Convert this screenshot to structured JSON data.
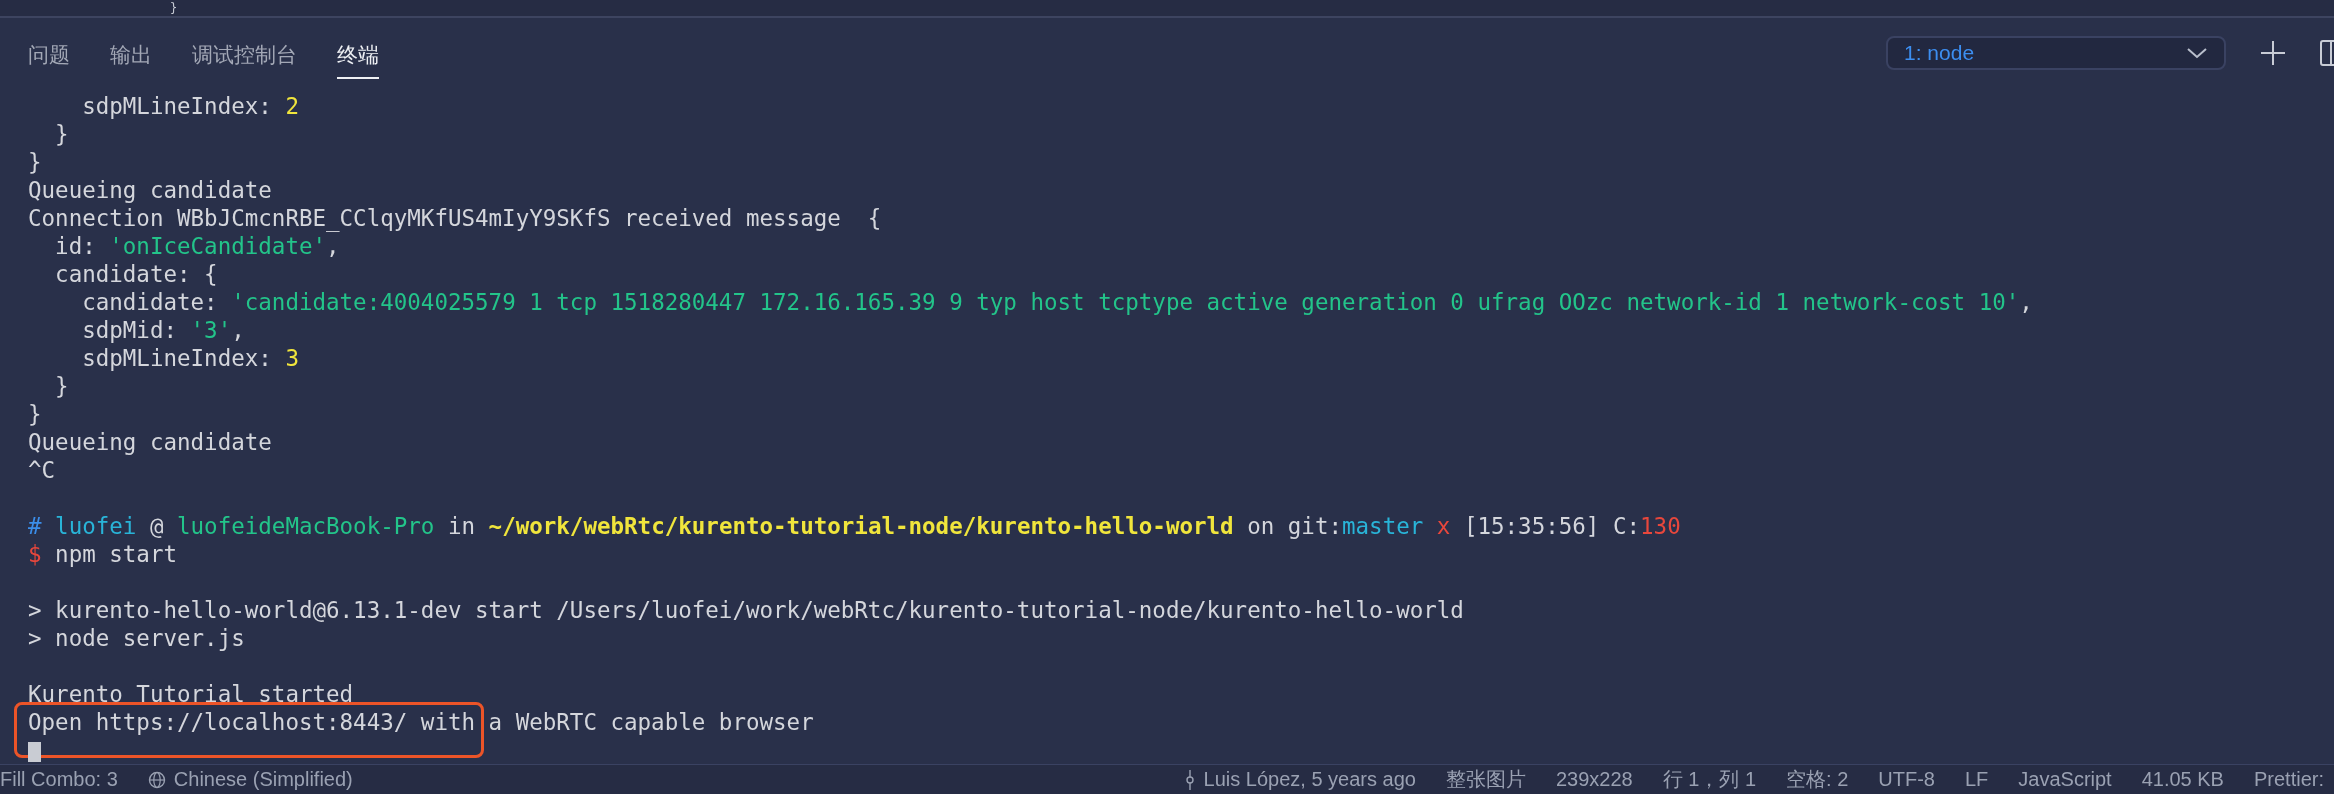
{
  "editor_remnant": {
    "text": "}"
  },
  "tabs": [
    {
      "label": "问题",
      "selected": false
    },
    {
      "label": "输出",
      "selected": false
    },
    {
      "label": "调试控制台",
      "selected": false
    },
    {
      "label": "终端",
      "selected": true
    }
  ],
  "terminal_select": {
    "value": "1: node"
  },
  "terminal": {
    "blocks": [
      {
        "lines": [
          {
            "segments": [
              {
                "text": "    sdpMLineIndex: ",
                "kind": "plain"
              },
              {
                "text": "2",
                "kind": "number"
              }
            ]
          },
          {
            "segments": [
              {
                "text": "  }",
                "kind": "plain"
              }
            ]
          },
          {
            "segments": [
              {
                "text": "}",
                "kind": "plain"
              }
            ]
          },
          {
            "segments": [
              {
                "text": "Queueing candidate",
                "kind": "plain"
              }
            ]
          },
          {
            "segments": [
              {
                "text": "Connection WBbJCmcnRBE_CClqyMKfUS4mIyY9SKfS received message  {",
                "kind": "plain"
              }
            ]
          },
          {
            "segments": [
              {
                "text": "  id: ",
                "kind": "plain"
              },
              {
                "text": "'onIceCandidate'",
                "kind": "string"
              },
              {
                "text": ",",
                "kind": "plain"
              }
            ]
          },
          {
            "segments": [
              {
                "text": "  candidate: {",
                "kind": "plain"
              }
            ]
          },
          {
            "segments": [
              {
                "text": "    candidate: ",
                "kind": "plain"
              },
              {
                "text": "'candidate:4004025579 1 tcp 1518280447 172.16.165.39 9 typ host tcptype active generation 0 ufrag OOzc network-id 1 network-cost 10'",
                "kind": "string"
              },
              {
                "text": ",",
                "kind": "plain"
              }
            ]
          },
          {
            "segments": [
              {
                "text": "    sdpMid: ",
                "kind": "plain"
              },
              {
                "text": "'3'",
                "kind": "string"
              },
              {
                "text": ",",
                "kind": "plain"
              }
            ]
          },
          {
            "segments": [
              {
                "text": "    sdpMLineIndex: ",
                "kind": "plain"
              },
              {
                "text": "3",
                "kind": "number"
              }
            ]
          },
          {
            "segments": [
              {
                "text": "  }",
                "kind": "plain"
              }
            ]
          },
          {
            "segments": [
              {
                "text": "}",
                "kind": "plain"
              }
            ]
          },
          {
            "segments": [
              {
                "text": "Queueing candidate",
                "kind": "plain"
              }
            ]
          },
          {
            "segments": [
              {
                "text": "^C",
                "kind": "plain"
              }
            ]
          }
        ]
      },
      {
        "lines": [
          {
            "segments": [
              {
                "text": "#",
                "kind": "hash"
              },
              {
                "text": " luofei",
                "kind": "user"
              },
              {
                "text": " @ ",
                "kind": "plain"
              },
              {
                "text": "luofeideMacBook-Pro",
                "kind": "host"
              },
              {
                "text": " in ",
                "kind": "plain"
              },
              {
                "text": "~/work/webRtc/kurento-tutorial-node/kurento-hello-world",
                "kind": "path"
              },
              {
                "text": " on git:",
                "kind": "plain"
              },
              {
                "text": "master",
                "kind": "user"
              },
              {
                "text": " x",
                "kind": "error"
              },
              {
                "text": " [15:35:56] C:",
                "kind": "plain"
              },
              {
                "text": "130",
                "kind": "error"
              }
            ]
          },
          {
            "segments": [
              {
                "text": "$",
                "kind": "error"
              },
              {
                "text": " npm start",
                "kind": "plain"
              }
            ]
          }
        ]
      },
      {
        "lines": [
          {
            "segments": [
              {
                "text": "> kurento-hello-world@6.13.1-dev start /Users/luofei/work/webRtc/kurento-tutorial-node/kurento-hello-world",
                "kind": "plain"
              }
            ]
          },
          {
            "segments": [
              {
                "text": "> node server.js",
                "kind": "plain"
              }
            ]
          }
        ]
      },
      {
        "lines": [
          {
            "segments": [
              {
                "text": "Kurento Tutorial started",
                "kind": "plain"
              }
            ]
          },
          {
            "highlighted": true,
            "segments": [
              {
                "text": "Open https://localhost:8443/ with a WebRTC capable browser",
                "kind": "plain"
              }
            ]
          }
        ]
      }
    ],
    "cursor": true
  },
  "status_bar": [
    {
      "text": "Fill Combo: 3",
      "kind": "plain"
    },
    {
      "text": "Chinese (Simplified)",
      "kind": "language"
    },
    {
      "text": "Luis López, 5 years ago",
      "kind": "blame",
      "push_right": true
    },
    {
      "text": "整张图片",
      "kind": "plain"
    },
    {
      "text": "239x228",
      "kind": "plain"
    },
    {
      "text": "行 1，列 1",
      "kind": "plain"
    },
    {
      "text": "空格: 2",
      "kind": "plain"
    },
    {
      "text": "UTF-8",
      "kind": "plain"
    },
    {
      "text": "LF",
      "kind": "plain"
    },
    {
      "text": "JavaScript",
      "kind": "plain"
    },
    {
      "text": "41.05 KB",
      "kind": "plain"
    },
    {
      "text": "Prettier:",
      "kind": "plain"
    }
  ]
}
